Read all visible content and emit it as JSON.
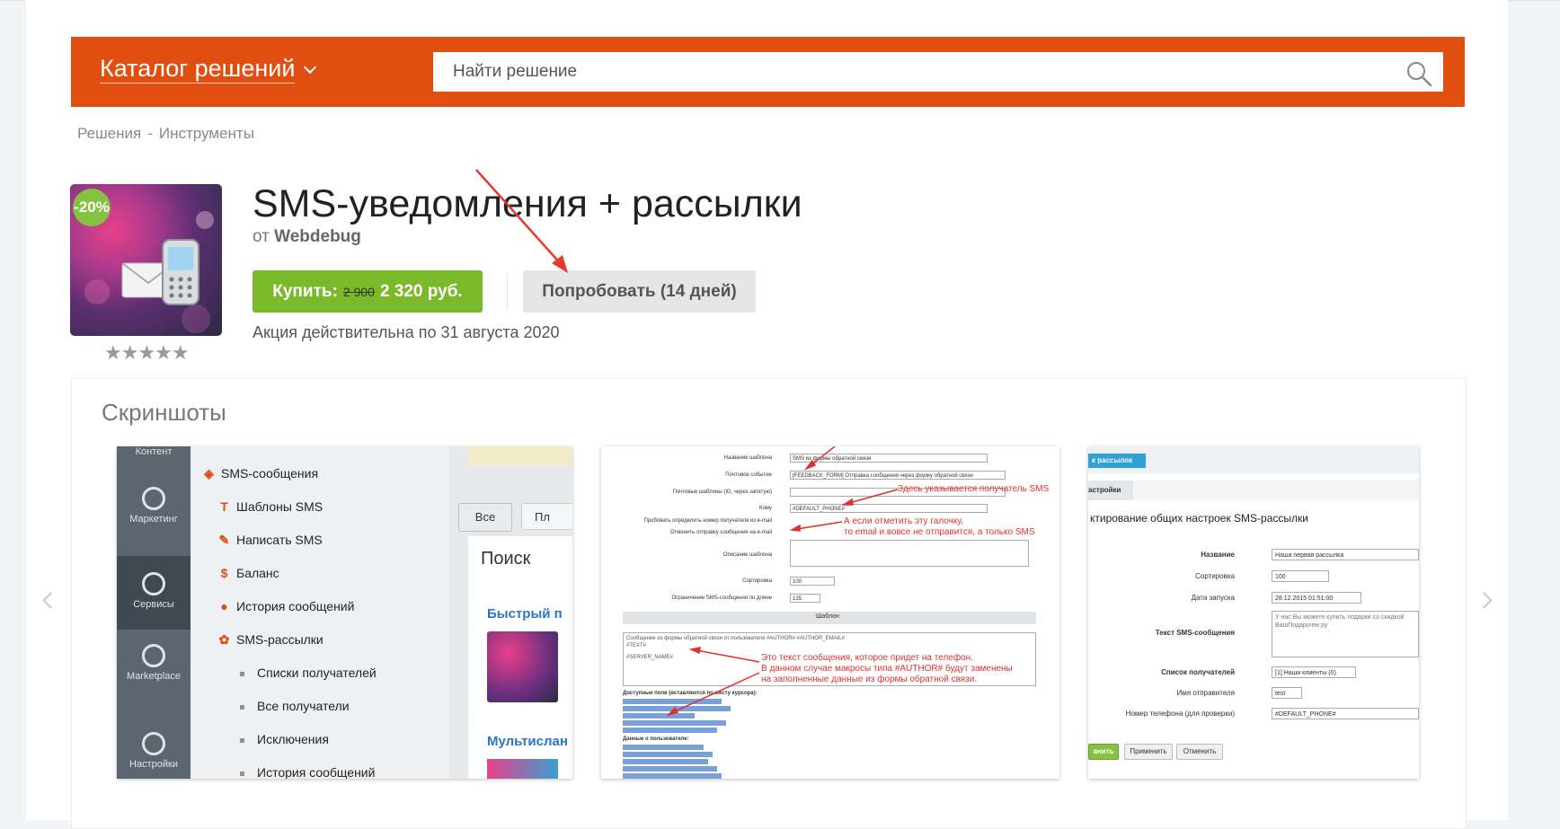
{
  "header": {
    "catalog_title": "Каталог решений",
    "search_placeholder": "Найти решение",
    "accent_color": "#e04e10"
  },
  "breadcrumb": {
    "items": [
      "Решения",
      "Инструменты"
    ],
    "separator": "-"
  },
  "product": {
    "discount_badge": "-20%",
    "rating_stars": 5,
    "title": "SMS-уведомления + рассылки",
    "by_prefix": "от",
    "vendor": "Webdebug",
    "buy": {
      "label": "Купить:",
      "old_price": "2 900",
      "new_price": "2 320 руб."
    },
    "try_label": "Попробовать (14 дней)",
    "promo_text": "Акция действительна по 31 августа 2020"
  },
  "screenshots": {
    "title": "Скриншоты",
    "shot1": {
      "sidebar": [
        "Контент",
        "Маркетинг",
        "Сервисы",
        "Marketplace",
        "Настройки"
      ],
      "tree": [
        {
          "icon": "sms-icon",
          "label": "SMS-сообщения"
        },
        {
          "icon": "template-icon",
          "label": "Шаблоны SMS"
        },
        {
          "icon": "pencil-icon",
          "label": "Написать SMS"
        },
        {
          "icon": "dollar-icon",
          "label": "Баланс"
        },
        {
          "icon": "clock-icon",
          "label": "История сообщений"
        },
        {
          "icon": "people-icon",
          "label": "SMS-рассылки"
        },
        {
          "label": "Списки получателей"
        },
        {
          "label": "Все получатели"
        },
        {
          "label": "Исключения"
        },
        {
          "label": "История сообщений"
        }
      ],
      "buttons": [
        "Все",
        "Пл"
      ],
      "search_label": "Поиск",
      "quick_label": "Быстрый п",
      "multi_label": "Мультислан"
    },
    "shot2": {
      "rows": [
        {
          "label": "Название шаблона",
          "value": "SMS из формы обратной связи"
        },
        {
          "label": "Почтовое событие",
          "value": "[FEEDBACK_FORM] Отправка сообщения через форму обратной связи"
        },
        {
          "label": "Почтовые шаблоны (ID, через запятую)",
          "value": ""
        },
        {
          "label": "Кому",
          "value": "#DEFAULT_PHONE#"
        },
        {
          "label": "Пробовать определить номер получателя из e-mail",
          "value": ""
        },
        {
          "label": "Отменить отправку сообщения на e-mail",
          "value": ""
        },
        {
          "label": "Описание шаблона",
          "value": ""
        },
        {
          "label": "Сортировка",
          "value": "100"
        },
        {
          "label": "Ограничение SMS-сообщения по длине",
          "value": "135"
        }
      ],
      "notes": [
        "Здесь указывается получатель SMS",
        "А если отметить эту галочку,",
        "то email и вовсе не отправится, а только SMS",
        "Это текст сообщения, которое придет на телефон.",
        "В данном случае макросы типа #AUTHOR# будут заменены",
        "на заполненные данные из формы обратной связи."
      ],
      "template_bar": "Шаблон",
      "message_text": [
        "Сообщение из формы обратной связи от пользователя #AUTHOR# #AUTHOR_EMAIL#",
        "#TEXT#",
        "#SERVER_NAME#"
      ],
      "fields_title": "Доступные поля (вставляются по месту курсора):",
      "user_fields_title": "Данные о пользователе:"
    },
    "shot3": {
      "tab": "к рассылок",
      "subtab": "астройки",
      "title": "ктирование общих настроек SMS-рассылки",
      "rows": [
        {
          "label": "Название",
          "value": "Наша первая рассылка",
          "bold": true
        },
        {
          "label": "Сортировка",
          "value": "100",
          "bold": false
        },
        {
          "label": "Дата запуска",
          "value": "28.12.2015 01:51:00",
          "bold": false
        },
        {
          "label": "Текст SMS-сообщения",
          "value": "У нас Вы можете купить подарки со скидкой ВашПодарочек.ру",
          "bold": true
        },
        {
          "label": "Список получателей",
          "value": "[1] Наши клиенты (0)",
          "bold": true
        },
        {
          "label": "Имя отправителя",
          "value": "test",
          "bold": false
        },
        {
          "label": "Номер телефона (для проверки)",
          "value": "#DEFAULT_PHONE#",
          "bold": false
        }
      ],
      "buttons": [
        "анить",
        "Применить",
        "Отменить"
      ]
    }
  }
}
